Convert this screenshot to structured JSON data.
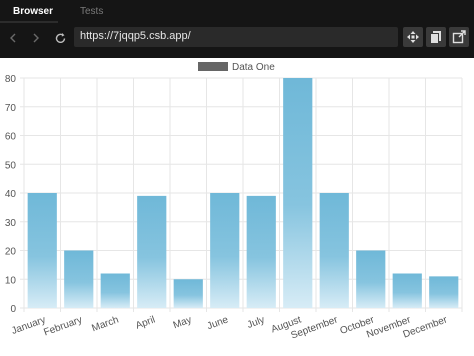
{
  "browser": {
    "tabs": [
      {
        "label": "Browser",
        "active": true
      },
      {
        "label": "Tests",
        "active": false
      }
    ],
    "url": "https://7jqqp5.csb.app/",
    "icons": [
      "back-icon",
      "forward-icon",
      "refresh-icon",
      "move-icon",
      "copy-icon",
      "external-link-icon"
    ],
    "colors": {
      "chrome": "#151515",
      "url_bar": "#2a2a2a",
      "bar_top": "#6fb8d8",
      "bar_bottom": "#d7ecf6"
    }
  },
  "chart_data": {
    "type": "bar",
    "categories": [
      "January",
      "February",
      "March",
      "April",
      "May",
      "June",
      "July",
      "August",
      "September",
      "October",
      "November",
      "December"
    ],
    "series": [
      {
        "name": "Data One",
        "values": [
          40,
          20,
          12,
          39,
          10,
          40,
          39,
          80,
          40,
          20,
          12,
          11
        ]
      }
    ],
    "ylim": [
      0,
      80
    ],
    "yticks": [
      0,
      10,
      20,
      30,
      40,
      50,
      60,
      70,
      80
    ],
    "grid": true,
    "legend": "top-center"
  }
}
